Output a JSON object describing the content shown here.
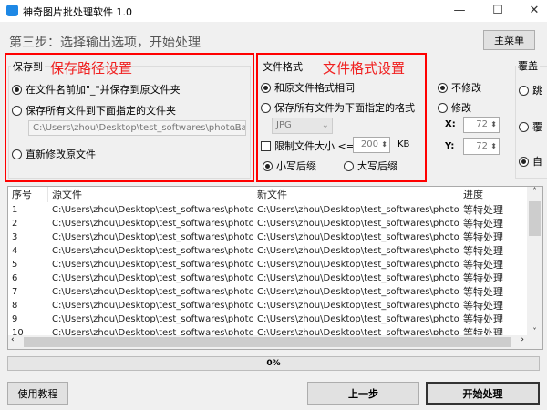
{
  "window": {
    "title": "神奇图片批处理软件 1.0",
    "minimize": "—",
    "maximize": "☐",
    "close": "✕"
  },
  "header": {
    "step": "第三步：选择输出选项，开始处理",
    "main_menu": "主菜单"
  },
  "save": {
    "group_label": "保存到",
    "annotation": "保存路径设置",
    "options": [
      {
        "label": "在文件名前加\"_\"并保存到原文件夹",
        "checked": true
      },
      {
        "label": "保存所有文件到下面指定的文件夹",
        "checked": false
      },
      {
        "label": "直新修改原文件",
        "checked": false
      }
    ],
    "path": "C:\\Users\\zhou\\Desktop\\test_softwares\\photoBatch",
    "browse": "..."
  },
  "format": {
    "group_label": "文件格式",
    "annotation": "文件格式设置",
    "options": [
      {
        "label": "和原文件格式相同",
        "checked": true
      },
      {
        "label": "保存所有文件为下面指定的格式",
        "checked": false
      }
    ],
    "format_select": "JPG",
    "limit_label": "限制文件大小 <=",
    "limit_checked": false,
    "limit_value": "200",
    "limit_unit": "KB",
    "lower_suffix": "小写后缀",
    "upper_suffix": "大写后缀",
    "suffix_selected": "lower"
  },
  "resolution": {
    "no_change": "不修改",
    "change": "修改",
    "selected": "no_change",
    "x_label": "X:",
    "x_value": "72",
    "y_label": "Y:",
    "y_value": "72"
  },
  "overwrite": {
    "group_label": "覆盖",
    "options": [
      {
        "label": "跳",
        "checked": false
      },
      {
        "label": "覆",
        "checked": false
      },
      {
        "label": "自",
        "checked": true
      }
    ]
  },
  "table": {
    "columns": [
      "序号",
      "源文件",
      "新文件",
      "进度"
    ],
    "rows": [
      [
        "1",
        "C:\\Users\\zhou\\Desktop\\test_softwares\\photoBat...",
        "C:\\Users\\zhou\\Desktop\\test_softwares\\photoBat...",
        "等特处理"
      ],
      [
        "2",
        "C:\\Users\\zhou\\Desktop\\test_softwares\\photoBat...",
        "C:\\Users\\zhou\\Desktop\\test_softwares\\photoBat...",
        "等特处理"
      ],
      [
        "3",
        "C:\\Users\\zhou\\Desktop\\test_softwares\\photoBat...",
        "C:\\Users\\zhou\\Desktop\\test_softwares\\photoBat...",
        "等特处理"
      ],
      [
        "4",
        "C:\\Users\\zhou\\Desktop\\test_softwares\\photoBat...",
        "C:\\Users\\zhou\\Desktop\\test_softwares\\photoBat...",
        "等特处理"
      ],
      [
        "5",
        "C:\\Users\\zhou\\Desktop\\test_softwares\\photoBat...",
        "C:\\Users\\zhou\\Desktop\\test_softwares\\photoBat...",
        "等特处理"
      ],
      [
        "6",
        "C:\\Users\\zhou\\Desktop\\test_softwares\\photoBat...",
        "C:\\Users\\zhou\\Desktop\\test_softwares\\photoBat...",
        "等特处理"
      ],
      [
        "7",
        "C:\\Users\\zhou\\Desktop\\test_softwares\\photoBat...",
        "C:\\Users\\zhou\\Desktop\\test_softwares\\photoBat...",
        "等特处理"
      ],
      [
        "8",
        "C:\\Users\\zhou\\Desktop\\test_softwares\\photoBat...",
        "C:\\Users\\zhou\\Desktop\\test_softwares\\photoBat...",
        "等特处理"
      ],
      [
        "9",
        "C:\\Users\\zhou\\Desktop\\test_softwares\\photoBat...",
        "C:\\Users\\zhou\\Desktop\\test_softwares\\photoBat...",
        "等特处理"
      ],
      [
        "10",
        "C:\\Users\\zhou\\Desktop\\test_softwares\\photoBat...",
        "C:\\Users\\zhou\\Desktop\\test_softwares\\photoBat...",
        "等特处理"
      ]
    ]
  },
  "progress": {
    "value": 0,
    "label": "0%"
  },
  "footer": {
    "tutorial": "使用教程",
    "prev": "上一步",
    "start": "开始处理"
  },
  "colors": {
    "annotation": "#f02020",
    "app_icon": "#1e88e5"
  }
}
